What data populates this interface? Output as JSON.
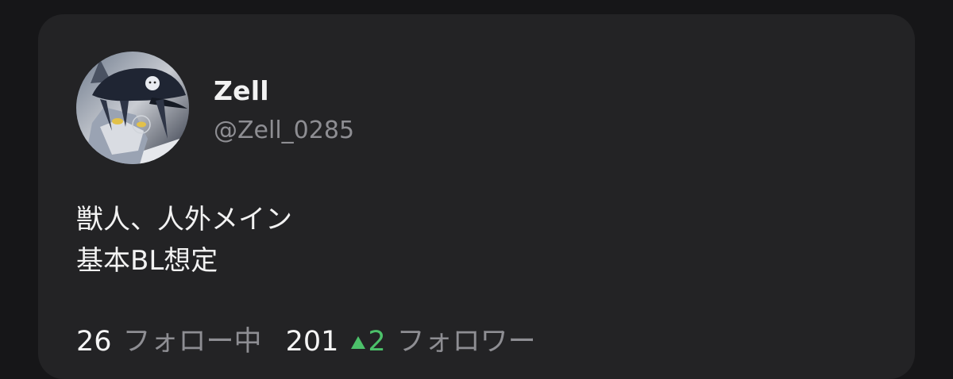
{
  "profile": {
    "display_name": "Zell",
    "handle": "@Zell_0285",
    "avatar_icon": "avatar-icon"
  },
  "bio": {
    "line1": "獣人、人外メイン",
    "line2": "基本BL想定"
  },
  "stats": {
    "following_count": "26",
    "following_label": "フォロー中",
    "followers_count": "201",
    "followers_delta": "2",
    "followers_label": "フォロワー"
  },
  "colors": {
    "background": "#161618",
    "card": "#232325",
    "text": "#f2f2f2",
    "muted": "#8e8e93",
    "positive": "#4cc16a"
  }
}
